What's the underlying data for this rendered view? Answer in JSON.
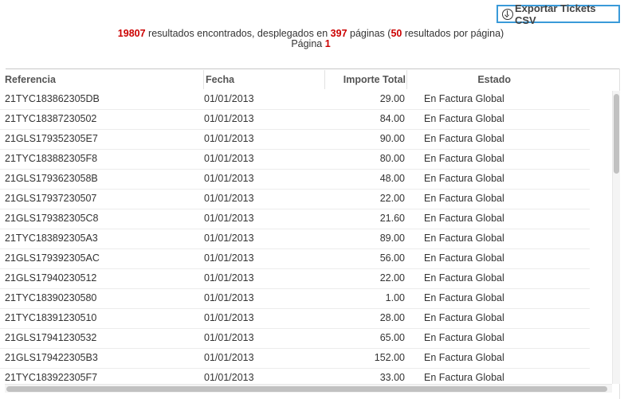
{
  "export_button": {
    "label": "Exportar Tickets CSV",
    "icon": "download-circle-icon"
  },
  "summary": {
    "total_results": "19807",
    "text_found": " resultados encontrados, desplegados en ",
    "total_pages": "397",
    "text_pages": " páginas (",
    "per_page": "50",
    "text_per_page": " resultados por página)",
    "page_label": "Página ",
    "current_page": "1"
  },
  "table": {
    "columns": [
      "Referencia",
      "Fecha",
      "Importe Total",
      "Estado"
    ],
    "rows": [
      [
        "21TYC183862305DB",
        "01/01/2013",
        "29.00",
        "En Factura Global"
      ],
      [
        "21TYC18387230502",
        "01/01/2013",
        "84.00",
        "En Factura Global"
      ],
      [
        "21GLS179352305E7",
        "01/01/2013",
        "90.00",
        "En Factura Global"
      ],
      [
        "21TYC183882305F8",
        "01/01/2013",
        "80.00",
        "En Factura Global"
      ],
      [
        "21GLS1793623058B",
        "01/01/2013",
        "48.00",
        "En Factura Global"
      ],
      [
        "21GLS17937230507",
        "01/01/2013",
        "22.00",
        "En Factura Global"
      ],
      [
        "21GLS179382305C8",
        "01/01/2013",
        "21.60",
        "En Factura Global"
      ],
      [
        "21TYC183892305A3",
        "01/01/2013",
        "89.00",
        "En Factura Global"
      ],
      [
        "21GLS179392305AC",
        "01/01/2013",
        "56.00",
        "En Factura Global"
      ],
      [
        "21GLS17940230512",
        "01/01/2013",
        "22.00",
        "En Factura Global"
      ],
      [
        "21TYC18390230580",
        "01/01/2013",
        "1.00",
        "En Factura Global"
      ],
      [
        "21TYC18391230510",
        "01/01/2013",
        "28.00",
        "En Factura Global"
      ],
      [
        "21GLS17941230532",
        "01/01/2013",
        "65.00",
        "En Factura Global"
      ],
      [
        "21GLS179422305B3",
        "01/01/2013",
        "152.00",
        "En Factura Global"
      ],
      [
        "21TYC183922305F7",
        "01/01/2013",
        "33.00",
        "En Factura Global"
      ]
    ]
  }
}
